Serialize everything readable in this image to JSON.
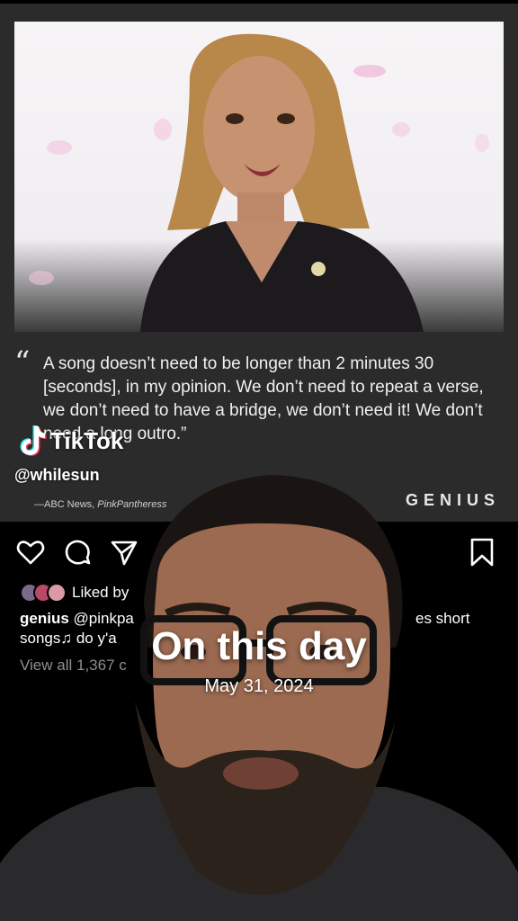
{
  "post": {
    "quote": "A song doesn’t need to be longer than 2 minutes 30 [seconds], in my opinion. We don’t need to repeat a verse, we don’t need to have a bridge, we don’t need it! We don’t need a long outro.”",
    "quote_mark": "“",
    "source_prefix": "—ABC News, ",
    "source_name": "PinkPantheress",
    "brand": "GENIUS"
  },
  "tiktok": {
    "wordmark": "TikTok",
    "handle": "@whilesun"
  },
  "instagram": {
    "liked_by": "Liked by",
    "caption_user": "genius",
    "caption_start": "@pinkpa",
    "caption_tail": "es short",
    "caption_line2": "songs♫  do y'a",
    "view_comments": "View all 1,367 c"
  },
  "memory": {
    "title": "On this day",
    "date": "May 31, 2024"
  },
  "icons": [
    "heart-icon",
    "comment-icon",
    "share-icon",
    "bookmark-icon",
    "tiktok-logo-icon"
  ],
  "colors": {
    "card_bg": "#2b2b2b",
    "page_bg": "#000000",
    "muted_text": "#8e8e8e"
  }
}
